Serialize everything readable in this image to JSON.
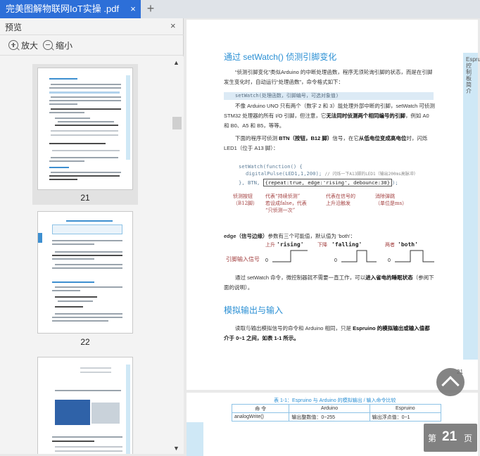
{
  "tab": {
    "title": "完美图解物联网IoT实操 .pdf",
    "close": "×",
    "add": "+"
  },
  "preview_panel": {
    "title": "预览",
    "close": "×",
    "zoom_in": "放大",
    "zoom_out": "缩小",
    "thumbnails": [
      {
        "page": "21",
        "selected": true
      },
      {
        "page": "22",
        "selected": false
      },
      {
        "page": "",
        "selected": false
      }
    ]
  },
  "document": {
    "side_label": "Espruino控制板简介",
    "heading1": "通过 setWatch() 侦测引脚变化",
    "para1": "“侦测引脚变化”类似Arduino 的中断处理函数，程序无须轮询引脚的状态，而是在引脚发生变化时，自动运行“处理函数”，命令格式如下：",
    "code_format": "setWatch(处理函数，引脚编号，可选对象值)",
    "para2_a": "不像 Arduino UNO 只有两个（数字 2 和 3）能处理外部中断的引脚，setWatch 可侦测 STM32 处理器的所有 I/O 引脚，但注意，它",
    "para2_bold": "无法同时侦测两个相同编号的引脚",
    "para2_b": "，例如 A0 和 B0、A5 和 B5，等等。",
    "para3_a": "下面的程序可侦测 ",
    "para3_b1": "BTN（按钮，B12 脚）",
    "para3_c": "信号，在它",
    "para3_b2": "从低电位变成高电位",
    "para3_d": "时，闪烁 LED1（位于 A13 脚）：",
    "code_line1": "setWatch(function() {",
    "code_line2": "digitalPulse(LED1,1,200);",
    "code_comment": "// 闪烁一下A13脚的LED1（输出200ms高脉冲）",
    "code_line3_a": "}, BTN, ",
    "code_line3_box": "{repeat:true, edge:'rising', debounce:30}",
    "code_line3_b": ");",
    "annotations": [
      "侦测按钮\n（B12脚）",
      "代表“持续侦测”\n若设成false，代表\n“只侦测一次”",
      "代表在信号的\n上升沿触发",
      "消除弹跳\n（单位是ms）"
    ],
    "edge_a": "edge（信号边缘）",
    "edge_b": "参数有三个可能值，默认值为 'both'：",
    "wave_input_label": "引脚输入信号",
    "waves": [
      {
        "note": "上升",
        "name": "'rising'"
      },
      {
        "note": "下降",
        "name": "'falling'"
      },
      {
        "note": "两者",
        "name": "'both'"
      }
    ],
    "wave_zero": "0",
    "para4_a": "通过 setWatch 命令，微控制器就不需要一直工作，可以",
    "para4_bold": "进入省电的睡眠状态",
    "para4_b": "（参阅下面的说明）。",
    "heading2": "模拟输出与输入",
    "para5_a": "读取与输出模拟信号的命令和 Arduino 相同，只是 ",
    "para5_bold": "Espruino 的模拟输出或输入值都介于 0~1 之间，如表 1-1 所示。",
    "page_number": "21",
    "table_title": "表 1-1：Espruino 与 Arduino 的模拟输出 / 输入命令比较",
    "table_header": [
      "命  令",
      "Arduino",
      "Espruino"
    ],
    "table_row": [
      "analogWrite()",
      "输出整数值：0~255",
      "输出浮点值：0~1"
    ]
  },
  "pager": {
    "prefix": "第",
    "page": "21",
    "suffix": "页"
  }
}
